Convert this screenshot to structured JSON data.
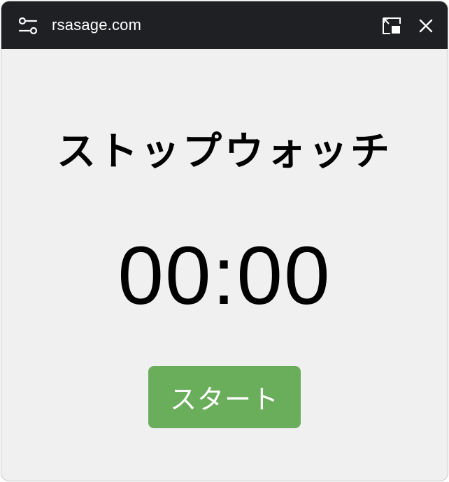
{
  "titlebar": {
    "site": "rsasage.com",
    "background": "#1f2024"
  },
  "icons": {
    "settings": "tune-icon",
    "pip": "picture-in-picture-icon",
    "close": "close-icon"
  },
  "main": {
    "heading": "ストップウォッチ",
    "time": "00:00",
    "start_label": "スタート",
    "accent": "#6aae5c",
    "background": "#f0f0f0"
  }
}
